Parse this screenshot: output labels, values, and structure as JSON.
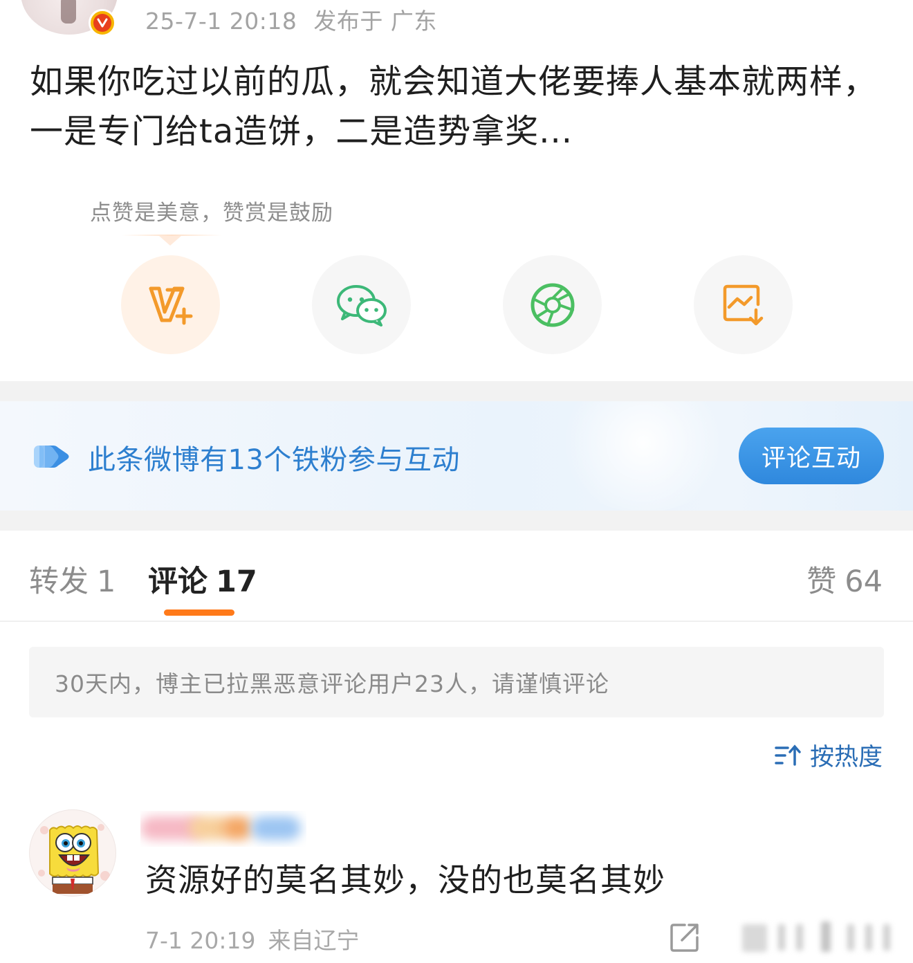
{
  "post": {
    "date": "25-7-1 20:18",
    "location": "发布于 广东",
    "text": "如果你吃过以前的瓜，就会知道大佬要捧人基本就两样，一是专门给ta造饼，二是造势拿奖..."
  },
  "share": {
    "tip": "点赞是美意，赞赏是鼓励",
    "buttons": [
      {
        "icon": "reward-v-plus-icon"
      },
      {
        "icon": "wechat-icon"
      },
      {
        "icon": "moments-shutter-icon"
      },
      {
        "icon": "save-image-icon"
      }
    ]
  },
  "fan_banner": {
    "text": "此条微博有13个铁粉参与互动",
    "cta": "评论互动"
  },
  "tabs": {
    "repost": {
      "label": "转发",
      "count": "1"
    },
    "comments": {
      "label": "评论",
      "count": "17"
    },
    "likes": {
      "label": "赞",
      "count": "64"
    }
  },
  "notice": "30天内，博主已拉黑恶意评论用户23人，请谨慎评论",
  "sort": {
    "label": "按热度"
  },
  "comments": [
    {
      "username": "",
      "text": "资源好的莫名其妙，没的也莫名其妙",
      "time": "7-1 20:19",
      "source": "来自辽宁"
    }
  ],
  "colors": {
    "accent_orange": "#ff7a1a",
    "link_blue": "#2d7fcf",
    "cta_blue": "#3993e4",
    "wechat_green": "#3cb878",
    "moments_green": "#4bbf62",
    "reward_orange": "#f39a2b"
  }
}
